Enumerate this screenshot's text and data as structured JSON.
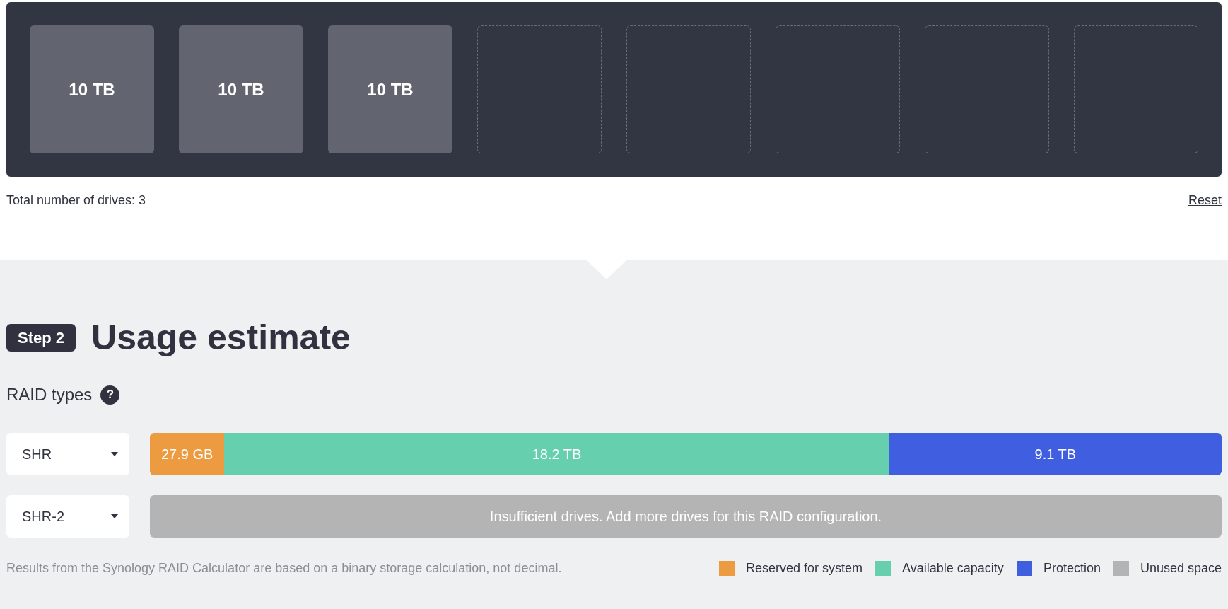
{
  "drive_bays": [
    {
      "filled": true,
      "label": "10 TB"
    },
    {
      "filled": true,
      "label": "10 TB"
    },
    {
      "filled": true,
      "label": "10 TB"
    },
    {
      "filled": false
    },
    {
      "filled": false
    },
    {
      "filled": false
    },
    {
      "filled": false
    },
    {
      "filled": false
    }
  ],
  "drive_count": "Total number of drives: 3",
  "reset_link": "Reset",
  "step": {
    "badge": "Step 2",
    "title": "Usage estimate"
  },
  "raid_types_label": "RAID types",
  "help_icon": "?",
  "raid_rows": [
    {
      "raid_type": "SHR",
      "kind": "segments",
      "segments": [
        {
          "kind": "reserved",
          "label": "27.9 GB",
          "color": "#ed9b40"
        },
        {
          "kind": "available",
          "label": "18.2 TB",
          "color": "#66d0ae"
        },
        {
          "kind": "protection",
          "label": "9.1 TB",
          "color": "#405ee0"
        }
      ]
    },
    {
      "raid_type": "SHR-2",
      "kind": "message",
      "message": "Insufficient drives. Add more drives for this RAID configuration.",
      "color": "#b4b4b4"
    }
  ],
  "footnote": "Results from the Synology RAID Calculator are based on a binary storage calculation, not decimal.",
  "legend": [
    {
      "label": "Reserved for system",
      "color": "#ed9b40"
    },
    {
      "label": "Available capacity",
      "color": "#66d0ae"
    },
    {
      "label": "Protection",
      "color": "#405ee0"
    },
    {
      "label": "Unused space",
      "color": "#b4b4b4"
    }
  ]
}
